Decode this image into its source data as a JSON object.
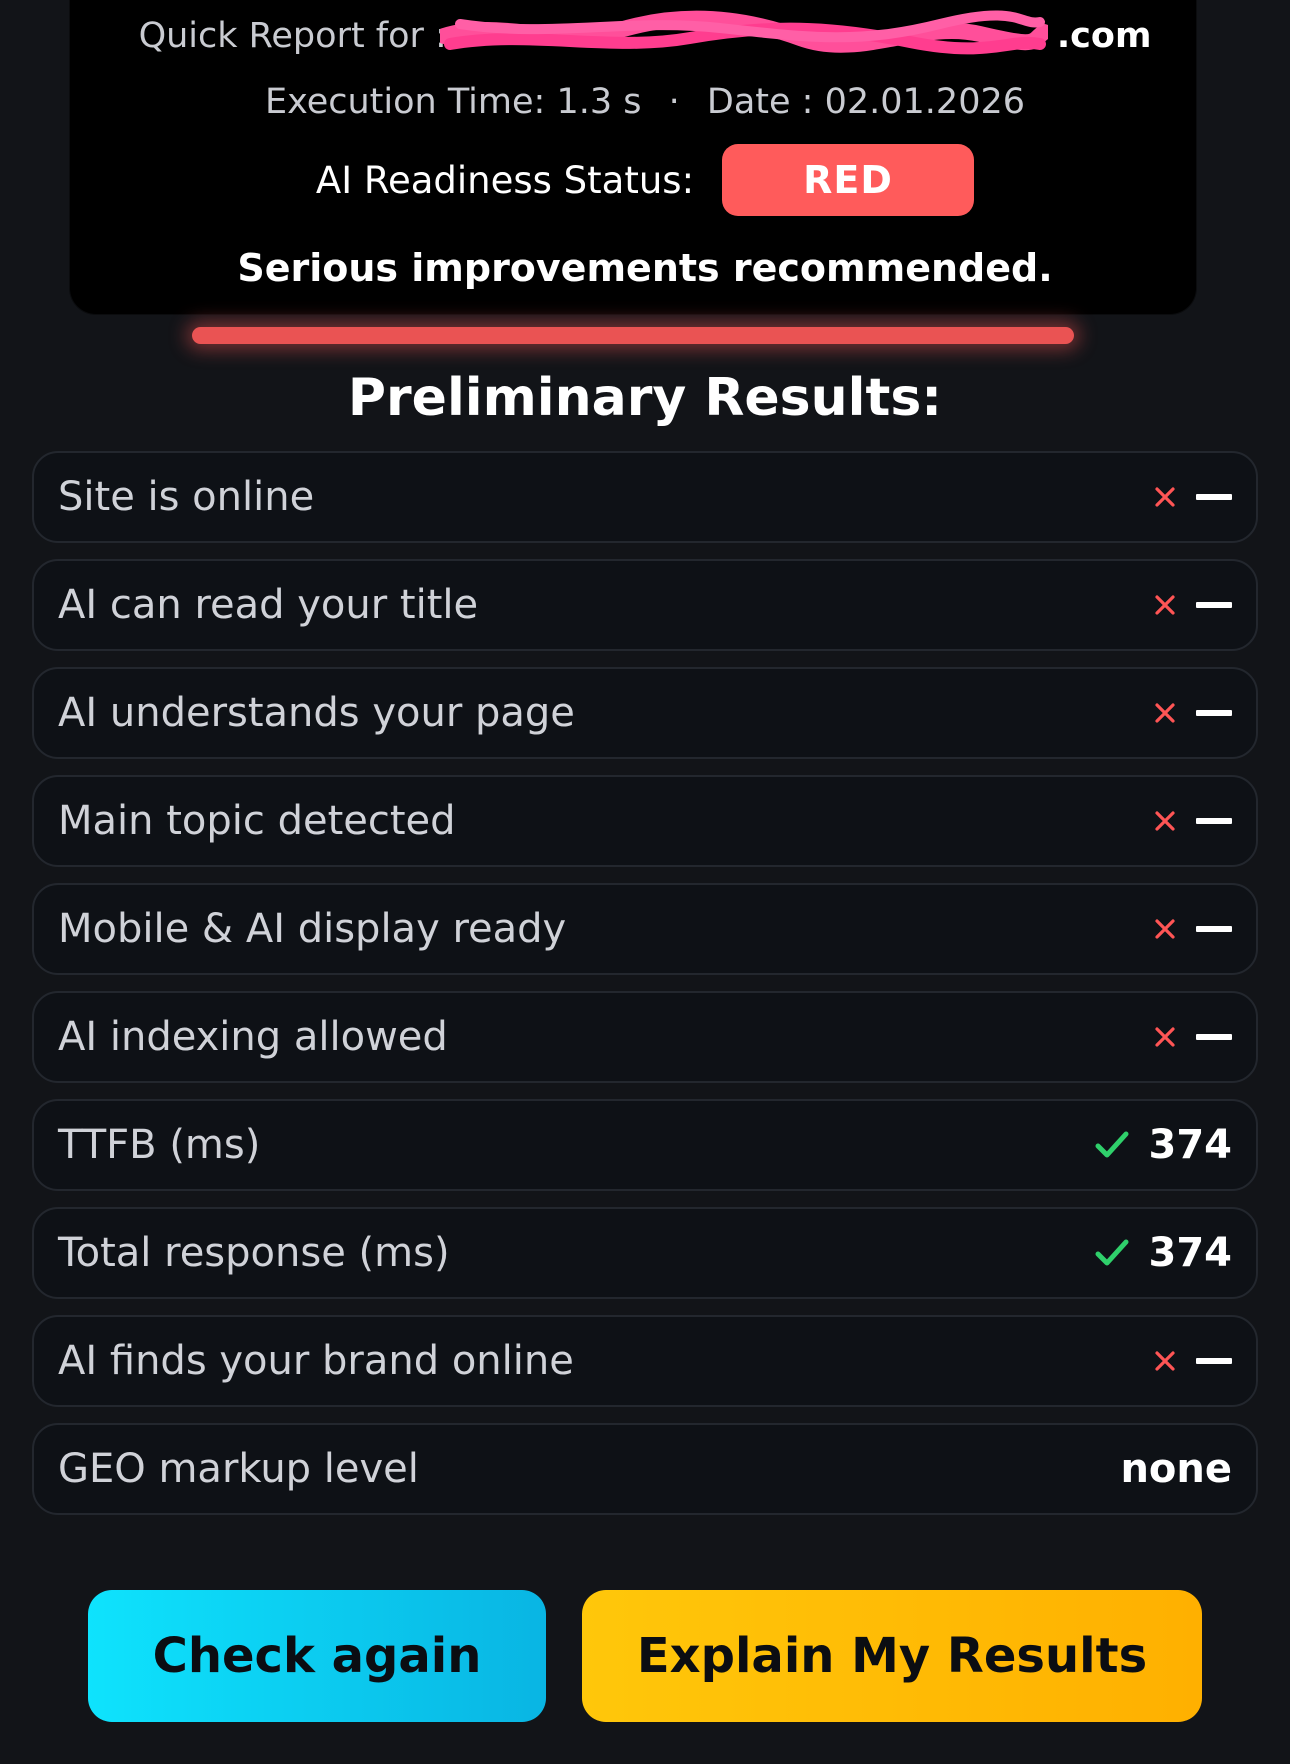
{
  "report": {
    "quick_report_label": "Quick Report for :",
    "domain_visible": ".com",
    "execution_time_label": "Execution Time:",
    "execution_time_value": "1.3 s",
    "separator": "·",
    "date_label": "Date :",
    "date_value": "02.01.2026",
    "status_label": "AI Readiness Status:",
    "status_value": "RED",
    "status_color": "#ff5b5b",
    "recommendation": "Serious improvements recommended."
  },
  "results": {
    "title": "Preliminary Results:",
    "rows": [
      {
        "label": "Site is online",
        "status": "fail",
        "icon": "x-icon",
        "value": ""
      },
      {
        "label": "AI can read your title",
        "status": "fail",
        "icon": "x-icon",
        "value": ""
      },
      {
        "label": "AI understands your page",
        "status": "fail",
        "icon": "x-icon",
        "value": ""
      },
      {
        "label": "Main topic detected",
        "status": "fail",
        "icon": "x-icon",
        "value": ""
      },
      {
        "label": "Mobile & AI display ready",
        "status": "fail",
        "icon": "x-icon",
        "value": ""
      },
      {
        "label": "AI indexing allowed",
        "status": "fail",
        "icon": "x-icon",
        "value": ""
      },
      {
        "label": "TTFB (ms)",
        "status": "pass",
        "icon": "check-icon",
        "value": "374"
      },
      {
        "label": "Total response (ms)",
        "status": "pass",
        "icon": "check-icon",
        "value": "374"
      },
      {
        "label": "AI finds your brand online",
        "status": "fail",
        "icon": "x-icon",
        "value": ""
      },
      {
        "label": "GEO markup level",
        "status": "text",
        "icon": "",
        "value": "none"
      }
    ]
  },
  "actions": {
    "check_again_label": "Check again",
    "explain_label": "Explain My Results"
  },
  "colors": {
    "fail": "#ff5555",
    "pass": "#2fd06b",
    "check_button": "#0ee3fd",
    "explain_button": "#ffc70a"
  }
}
